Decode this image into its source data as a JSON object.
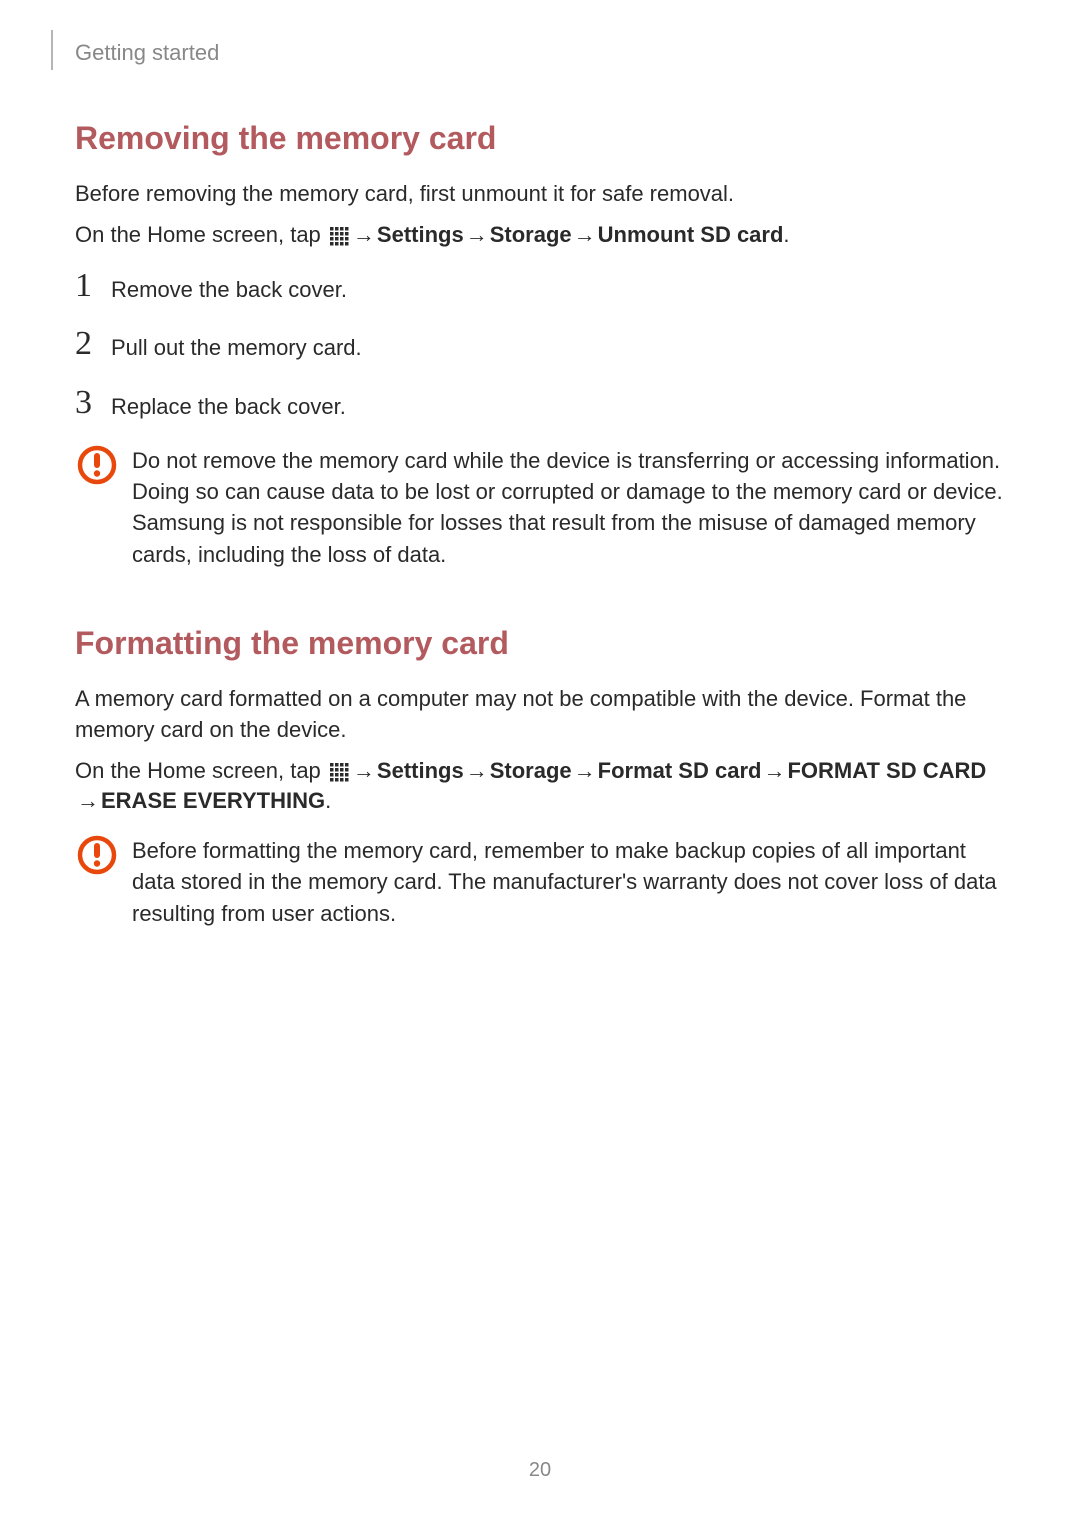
{
  "breadcrumb": "Getting started",
  "section1": {
    "title": "Removing the memory card",
    "intro": "Before removing the memory card, first unmount it for safe removal.",
    "nav": {
      "prefix": "On the Home screen, tap ",
      "arrow": " → ",
      "parts": [
        "Settings",
        "Storage",
        "Unmount SD card"
      ],
      "suffix": "."
    },
    "steps": [
      {
        "num": "1",
        "text": "Remove the back cover."
      },
      {
        "num": "2",
        "text": "Pull out the memory card."
      },
      {
        "num": "3",
        "text": "Replace the back cover."
      }
    ],
    "warning": "Do not remove the memory card while the device is transferring or accessing information. Doing so can cause data to be lost or corrupted or damage to the memory card or device. Samsung is not responsible for losses that result from the misuse of damaged memory cards, including the loss of data."
  },
  "section2": {
    "title": "Formatting the memory card",
    "intro": "A memory card formatted on a computer may not be compatible with the device. Format the memory card on the device.",
    "nav": {
      "prefix": "On the Home screen, tap ",
      "arrow": " → ",
      "parts": [
        "Settings",
        "Storage",
        "Format SD card",
        "FORMAT SD CARD",
        "ERASE EVERYTHING"
      ],
      "suffix": "."
    },
    "warning": "Before formatting the memory card, remember to make backup copies of all important data stored in the memory card. The manufacturer's warranty does not cover loss of data resulting from user actions."
  },
  "pageNumber": "20"
}
